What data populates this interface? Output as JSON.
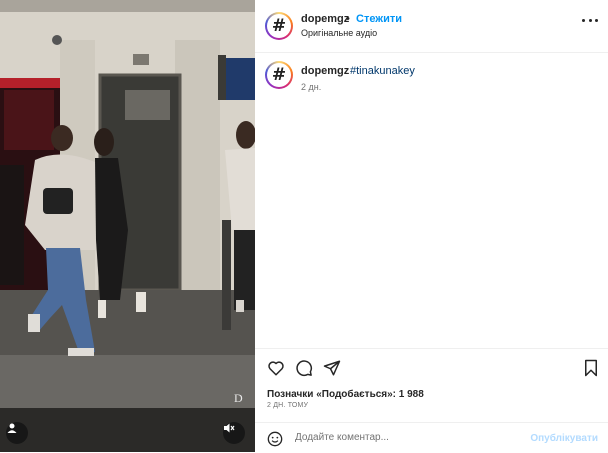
{
  "header": {
    "username": "dopemgz",
    "separator": "•",
    "follow_label": "Стежити",
    "audio_label": "Оригінальне аудіо",
    "avatar_glyph": "#",
    "more_icon": "more-horizontal-icon"
  },
  "caption": {
    "username": "dopemgz",
    "hashtag": "#tinakunakey",
    "time": "2 дн.",
    "avatar_glyph": "#"
  },
  "actions": {
    "like_icon": "heart-icon",
    "comment_icon": "comment-icon",
    "share_icon": "send-icon",
    "save_icon": "bookmark-icon",
    "likes_text": "Позначки «Подобається»: 1 988",
    "date_text": "2 ДН. ТОМУ"
  },
  "comment": {
    "placeholder": "Додайте коментар...",
    "publish_label": "Опублікувати"
  },
  "media": {
    "watermark": "D",
    "user_icon": "user-icon",
    "mute_icon": "speaker-muted-icon"
  },
  "colors": {
    "accent": "#0095f6",
    "link": "#00376b",
    "muted": "#737373",
    "publish_disabled": "#b3dbff"
  }
}
